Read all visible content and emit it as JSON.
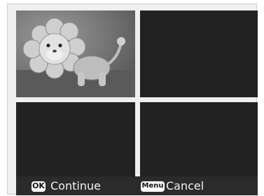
{
  "thumbnails": [
    {
      "icon": "crochet-lion-photo",
      "filled": true
    },
    {
      "filled": false
    },
    {
      "filled": false
    },
    {
      "filled": false
    }
  ],
  "footer": {
    "ok_key": "OK",
    "continue_label": "Continue",
    "menu_key": "Menu",
    "cancel_label": "Cancel"
  },
  "colors": {
    "cell_bg": "#222222",
    "bar_bg": "#2b2b2b",
    "frame_bg": "#efefef"
  }
}
